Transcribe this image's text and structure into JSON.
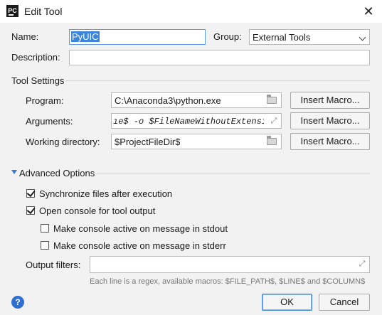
{
  "window": {
    "title": "Edit Tool",
    "app_icon": "PC",
    "close_glyph": "✕"
  },
  "name": {
    "label": "Name:",
    "value": "PyUIC"
  },
  "group": {
    "label": "Group:",
    "value": "External Tools"
  },
  "description": {
    "label": "Description:",
    "value": ""
  },
  "tool_settings": {
    "header": "Tool Settings",
    "program": {
      "label": "Program:",
      "value": "C:\\Anaconda3\\python.exe"
    },
    "arguments": {
      "label": "Arguments:",
      "value": "ıe$ -o $FileNameWithoutExtension$.py"
    },
    "working_directory": {
      "label": "Working directory:",
      "value": "$ProjectFileDir$"
    },
    "insert_macro_label": "Insert Macro..."
  },
  "advanced": {
    "header": "Advanced Options",
    "sync_files": {
      "label": "Synchronize files after execution",
      "checked": true
    },
    "open_console": {
      "label": "Open console for tool output",
      "checked": true
    },
    "active_stdout": {
      "label": "Make console active on message in stdout",
      "checked": false
    },
    "active_stderr": {
      "label": "Make console active on message in stderr",
      "checked": false
    },
    "output_filters": {
      "label": "Output filters:",
      "value": ""
    },
    "hint": "Each line is a regex, available macros: $FILE_PATH$, $LINE$ and $COLUMN$"
  },
  "footer": {
    "ok_label": "OK",
    "cancel_label": "Cancel",
    "help_glyph": "?"
  },
  "colors": {
    "accent": "#2f6fd2",
    "selection_bg": "#3d85d8",
    "dialog_bg": "#f2f2f2"
  }
}
